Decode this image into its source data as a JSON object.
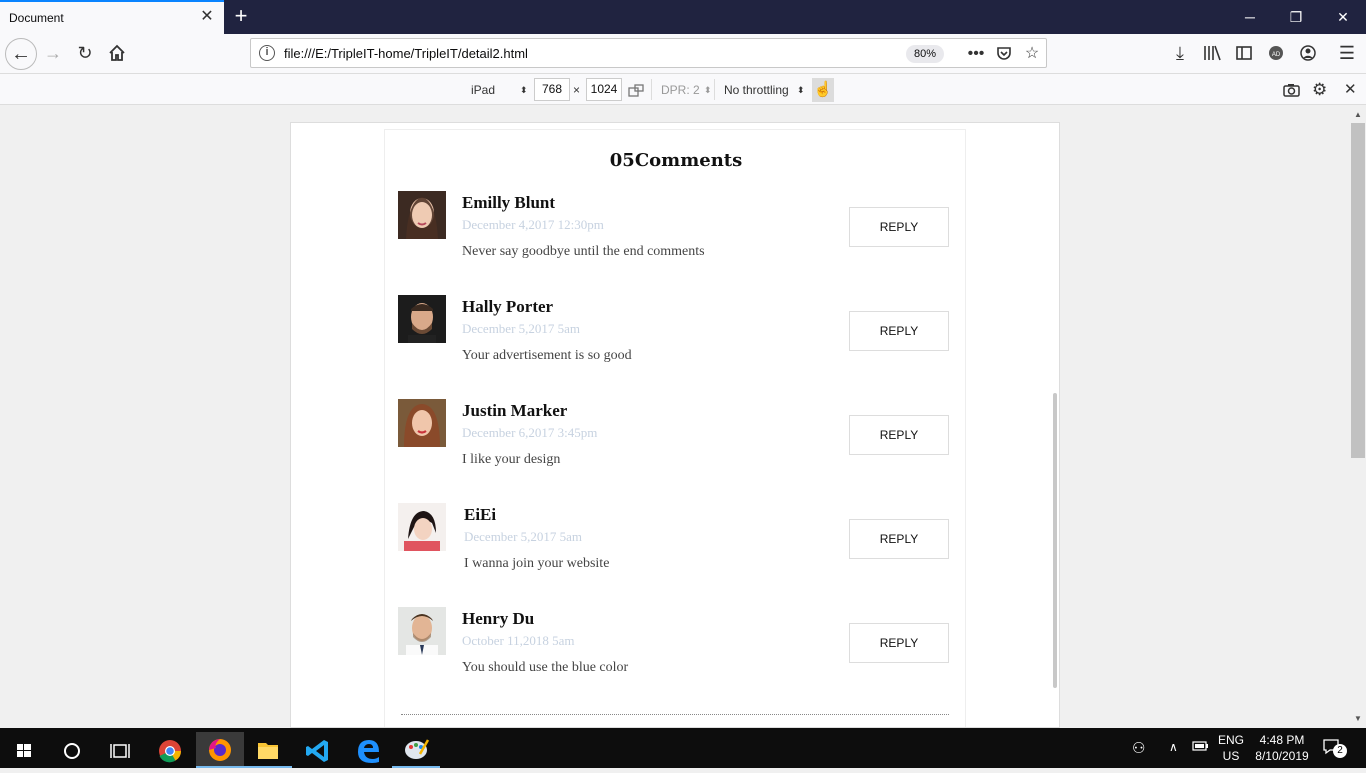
{
  "browser": {
    "tab_title": "Document",
    "tab_close": "✕",
    "new_tab": "+",
    "window_controls": {
      "minimize": "─",
      "restore": "❐",
      "close": "✕"
    },
    "url": "file:///E:/TripleIT-home/TripleIT/detail2.html",
    "zoom": "80%",
    "icons": [
      "back-icon",
      "forward-icon",
      "reload-icon",
      "home-icon",
      "info-icon",
      "more-icon",
      "pocket-icon",
      "bookmark-star-icon",
      "download-icon",
      "library-icon",
      "sidebar-icon",
      "extension-icon",
      "account-icon",
      "menu-icon"
    ]
  },
  "rdm": {
    "device": "iPad",
    "width": "768",
    "times": "×",
    "height": "1024",
    "dpr": "DPR: 2",
    "throttling": "No throttling"
  },
  "comments_section": {
    "title": "05Comments",
    "reply_label": "REPLY",
    "comments": [
      {
        "name": "Emilly Blunt",
        "date": "December 4,2017 12:30pm",
        "text": "Never say goodbye until the end comments"
      },
      {
        "name": "Hally Porter",
        "date": "December 5,2017 5am",
        "text": "Your advertisement is so good"
      },
      {
        "name": "Justin Marker",
        "date": "December 6,2017 3:45pm",
        "text": "I like your design"
      },
      {
        "name": "EiEi",
        "date": "December 5,2017 5am",
        "text": "I wanna join your website"
      },
      {
        "name": "Henry Du",
        "date": "October 11,2018 5am",
        "text": "You should use the blue color"
      }
    ]
  },
  "taskbar": {
    "apps": [
      "windows-start-icon",
      "cortana-icon",
      "task-view-icon",
      "chrome-icon",
      "firefox-icon",
      "file-explorer-icon",
      "vscode-icon",
      "edge-icon",
      "paint-icon"
    ],
    "lang_top": "ENG",
    "lang_bottom": "US",
    "time": "4:48 PM",
    "date": "8/10/2019",
    "notification_count": "2"
  },
  "colors": {
    "titlebar": "#202340",
    "accent": "#0a84ff",
    "date_text": "#c7d2e0"
  }
}
